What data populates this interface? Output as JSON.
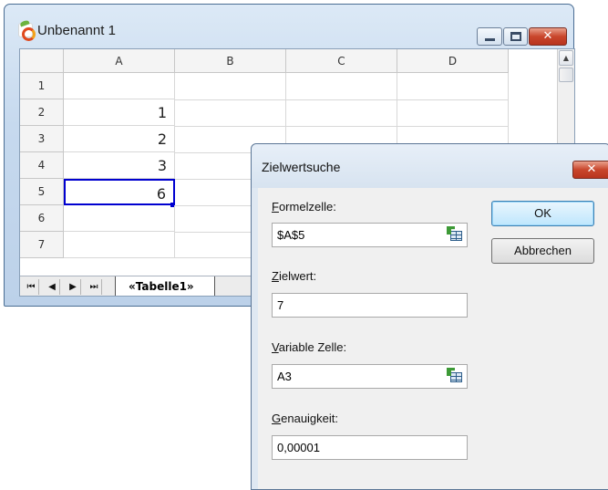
{
  "calc_window": {
    "title": "Unbenannt 1",
    "columns": [
      "A",
      "B",
      "C",
      "D"
    ],
    "rows": [
      "1",
      "2",
      "3",
      "4",
      "5",
      "6",
      "7"
    ],
    "cells_A": [
      "",
      "1",
      "2",
      "3",
      "6",
      "",
      ""
    ],
    "sheet_nav": [
      "⏮",
      "◀",
      "▶",
      "⏭"
    ],
    "sheet_tab": "«Tabelle1»",
    "selected_cell": "A5"
  },
  "dialog": {
    "title": "Zielwertsuche",
    "close_label": "✕",
    "formula_cell_label_accel": "F",
    "formula_cell_label_rest": "ormelzelle:",
    "formula_cell_value": "$A$5",
    "target_value_label_accel": "Z",
    "target_value_label_rest": "ielwert:",
    "target_value": "7",
    "variable_cell_label_accel": "V",
    "variable_cell_label_rest": "ariable Zelle:",
    "variable_cell_value": "A3",
    "accuracy_label_accel": "G",
    "accuracy_label_rest": "enauigkeit:",
    "accuracy_value": "0,00001",
    "ok_label": "OK",
    "cancel_label": "Abbrechen"
  },
  "colors": {
    "selection": "#0000d0",
    "close_red": "#c9462c",
    "default_button": "#bee6fd"
  }
}
